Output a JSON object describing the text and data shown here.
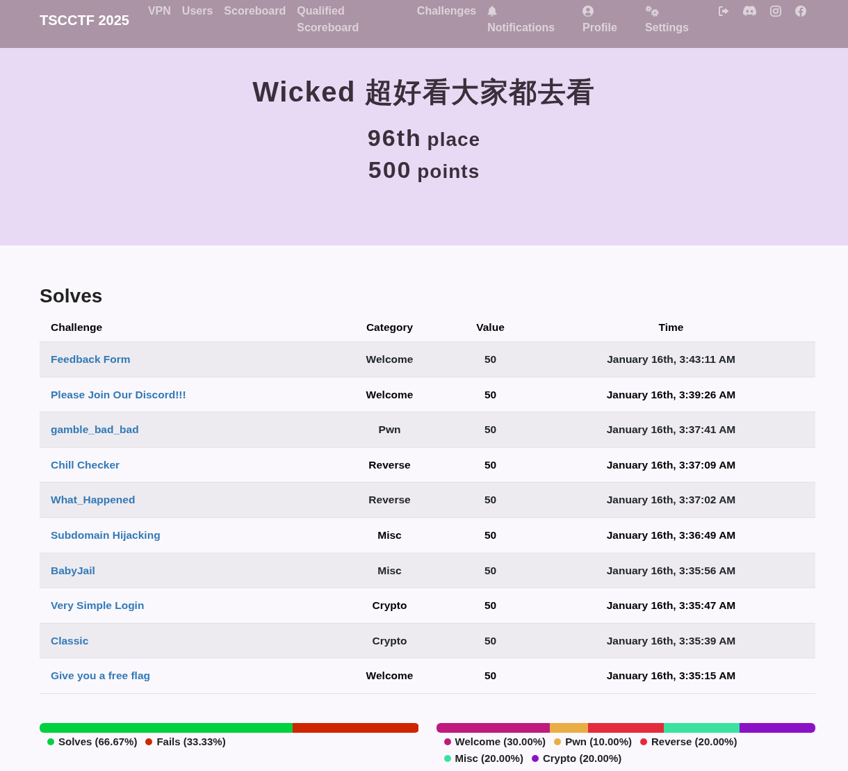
{
  "navbar": {
    "brand": "TSCCTF 2025",
    "left_links": [
      {
        "label": "VPN"
      },
      {
        "label": "Users"
      },
      {
        "label": "Scoreboard"
      },
      {
        "label": "Qualified Scoreboard"
      }
    ],
    "right_links": [
      {
        "label": "Challenges",
        "kind": "page"
      },
      {
        "label": "Notifications",
        "kind": "notifications"
      },
      {
        "label": "Profile",
        "kind": "profile"
      },
      {
        "label": "Settings",
        "kind": "settings"
      }
    ]
  },
  "team": {
    "name": "Wicked 超好看大家都去看",
    "place": {
      "number": "96th",
      "label": "place"
    },
    "points": {
      "number": "500",
      "label": "points"
    }
  },
  "solves": {
    "title": "Solves",
    "columns": [
      "Challenge",
      "Category",
      "Value",
      "Time"
    ],
    "rows": [
      {
        "challenge": "Feedback Form",
        "category": "Welcome",
        "value": "50",
        "time": "January 16th, 3:43:11 AM"
      },
      {
        "challenge": "Please Join Our Discord!!!",
        "category": "Welcome",
        "value": "50",
        "time": "January 16th, 3:39:26 AM"
      },
      {
        "challenge": "gamble_bad_bad",
        "category": "Pwn",
        "value": "50",
        "time": "January 16th, 3:37:41 AM"
      },
      {
        "challenge": "Chill Checker",
        "category": "Reverse",
        "value": "50",
        "time": "January 16th, 3:37:09 AM"
      },
      {
        "challenge": "What_Happened",
        "category": "Reverse",
        "value": "50",
        "time": "January 16th, 3:37:02 AM"
      },
      {
        "challenge": "Subdomain Hijacking",
        "category": "Misc",
        "value": "50",
        "time": "January 16th, 3:36:49 AM"
      },
      {
        "challenge": "BabyJail",
        "category": "Misc",
        "value": "50",
        "time": "January 16th, 3:35:56 AM"
      },
      {
        "challenge": "Very Simple Login",
        "category": "Crypto",
        "value": "50",
        "time": "January 16th, 3:35:47 AM"
      },
      {
        "challenge": "Classic",
        "category": "Crypto",
        "value": "50",
        "time": "January 16th, 3:35:39 AM"
      },
      {
        "challenge": "Give you a free flag",
        "category": "Welcome",
        "value": "50",
        "time": "January 16th, 3:35:15 AM"
      }
    ]
  },
  "solve_ratio": {
    "segments": [
      {
        "label": "Solves (66.67%)",
        "color": "#00d13f"
      },
      {
        "label": "Fails (33.33%)",
        "color": "#cf2600"
      }
    ]
  },
  "category_breakdown": {
    "segments": [
      {
        "label": "Welcome (30.00%)",
        "color": "#be1a7e"
      },
      {
        "label": "Pwn (10.00%)",
        "color": "#e8ae45"
      },
      {
        "label": "Reverse (20.00%)",
        "color": "#e42b3c"
      },
      {
        "label": "Misc (20.00%)",
        "color": "#3be29f"
      },
      {
        "label": "Crypto (20.00%)",
        "color": "#8b11c6"
      }
    ]
  }
}
